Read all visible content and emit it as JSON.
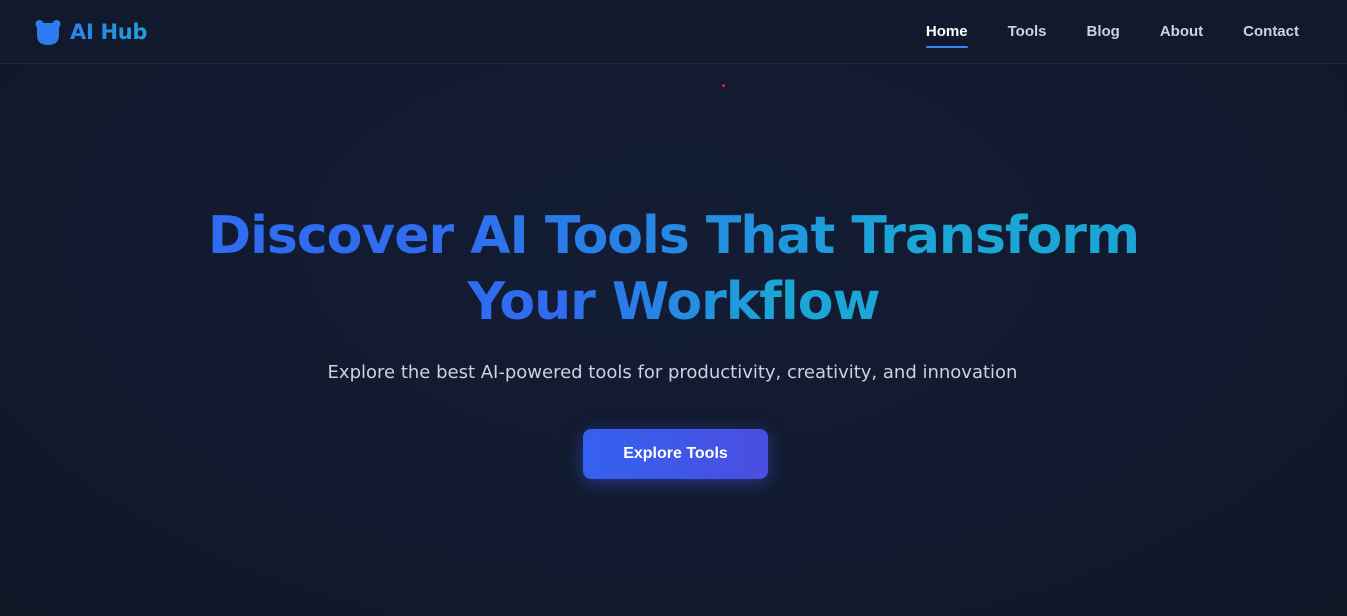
{
  "header": {
    "logo_text": "AI Hub",
    "logo_icon": "bear-icon",
    "nav": [
      {
        "label": "Home",
        "active": true
      },
      {
        "label": "Tools",
        "active": false
      },
      {
        "label": "Blog",
        "active": false
      },
      {
        "label": "About",
        "active": false
      },
      {
        "label": "Contact",
        "active": false
      }
    ]
  },
  "hero": {
    "title_line1": "Discover AI Tools That Transform",
    "title_line2": "Your Workflow",
    "subtitle": "Explore the best AI-powered tools for productivity, creativity, and innovation",
    "cta_label": "Explore Tools"
  },
  "colors": {
    "background": "#111a2e",
    "accent_blue": "#3b82f6",
    "gradient_start": "#2f6cf0",
    "gradient_end": "#1ba6d6",
    "cta_start": "#3461ef",
    "cta_end": "#4a4ee0"
  }
}
